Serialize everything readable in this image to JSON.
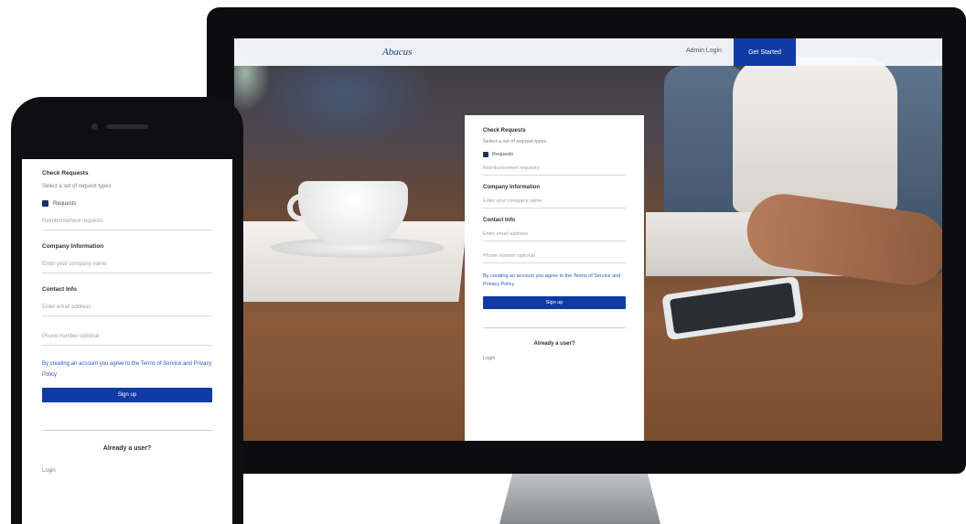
{
  "brand_color": "#103aa4",
  "site": {
    "logo": "Abacus",
    "signin": "Admin Login",
    "cta": "Get Started"
  },
  "desktop_form": {
    "section_label": "Check Requests",
    "section_sub": "Select a set of request types",
    "check_label": "Requests",
    "check_sub": "Reimbursement requests",
    "company_label": "Company Information",
    "company_placeholder": "Enter your company name",
    "contact_label": "Contact Info",
    "contact_placeholder": "Enter email address",
    "phone_placeholder": "Phone number optional",
    "terms": "By creating an account you agree to the Terms of Service and Privacy Policy",
    "submit": "Sign up",
    "question": "Already a user?",
    "footer": "Login"
  },
  "phone_form": {
    "section_label": "Check Requests",
    "section_sub": "Select a set of request types",
    "check_label": "Requests",
    "check_sub": "Reimbursement requests",
    "company_label": "Company Information",
    "company_placeholder": "Enter your company name",
    "contact_label": "Contact Info",
    "contact_placeholder": "Enter email address",
    "phone_placeholder": "Phone number optional",
    "terms": "By creating an account you agree to the Terms of Service and Privacy Policy",
    "submit": "Sign up",
    "question": "Already a user?",
    "footer": "Login"
  }
}
